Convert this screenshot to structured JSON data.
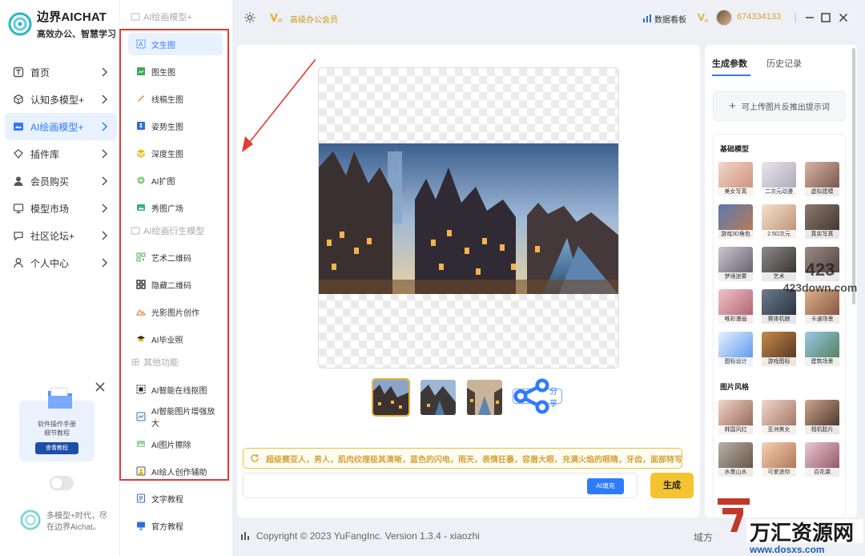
{
  "app": {
    "brand_title": "边界AICHAT",
    "brand_subtitle": "高效办公、智慧学习"
  },
  "sidebar": {
    "items": [
      {
        "label": "首页",
        "icon": "text-box-icon"
      },
      {
        "label": "认知多模型+",
        "icon": "cube-icon"
      },
      {
        "label": "AI绘画模型+",
        "icon": "canvas-icon",
        "active": true
      },
      {
        "label": "插件库",
        "icon": "plugin-icon"
      },
      {
        "label": "会员购买",
        "icon": "user-icon"
      },
      {
        "label": "模型市场",
        "icon": "market-icon"
      },
      {
        "label": "社区论坛+",
        "icon": "chat-bubble-icon"
      },
      {
        "label": "个人中心",
        "icon": "person-icon"
      }
    ],
    "promo": {
      "line1": "软件操作手册",
      "line2": "细节教程",
      "button": "查看教程"
    },
    "footer_text": "多模型+时代，尽在边界Aichat。"
  },
  "submenu": {
    "section1": "AI绘画模型+",
    "section1_items": [
      "文生图",
      "图生图",
      "线稿生图",
      "姿势生图",
      "深度生图",
      "AI扩图",
      "秀图广场"
    ],
    "section2": "AI绘画衍生模型",
    "section2_items": [
      "艺术二维码",
      "隐藏二维码",
      "光影图片创作",
      "AI毕业照"
    ],
    "section3": "其他功能",
    "section3_items": [
      "AI智能在线抠图",
      "AI智能图片增强放大",
      "AI图片擦除",
      "AI绘人创作辅助",
      "文字教程",
      "官方教程"
    ],
    "active_item": "文生图"
  },
  "topbar": {
    "vip_label": "高级办公会员",
    "dashboard_label": "数据看板",
    "user_id": "674334133",
    "accent": "#c99a1d"
  },
  "main": {
    "share_label": "分享",
    "prompt_text": "超级赛亚人，男人，肌肉纹理极其清晰，蓝色的闪电，雨天，表情狂暴，容眉大眼，充满火焰的眼睛，牙齿，面部特写",
    "fill_button": "AI填充",
    "generate_button": "生成",
    "thumbnail_count": 3
  },
  "right_panel": {
    "tabs": [
      "生成参数",
      "历史记录"
    ],
    "upload_label": "可上传图片反推出提示词",
    "base_models_title": "基础模型",
    "base_models": [
      "美女写真",
      "二次元动漫",
      "虚拟建模",
      "游戏3D角色",
      "2.5D次元",
      "真实写真",
      "梦境迷雾",
      "艺术",
      "",
      "唯彩漫画",
      "赛体机娘",
      "卡通场景",
      "图标设计",
      "游戏图标",
      "建筑场景"
    ],
    "styles_title": "图片风格",
    "styles": [
      "韩国风红",
      "亚洲美女",
      "相机胶片",
      "水墨山水",
      "可爱迷你",
      "百花瀛"
    ]
  },
  "footer": {
    "copyright": "Copyright © 2023 YuFangInc. Version 1.3.4 - xiaozhi",
    "domain_label": "域方"
  },
  "watermarks": {
    "top_right": "423down.com",
    "bottom_cn": "万汇资源网",
    "bottom_url": "www.dosxs.com"
  },
  "colors": {
    "primary": "#2f7bff",
    "gold": "#f4c430",
    "highlight_frame": "#e53935"
  }
}
